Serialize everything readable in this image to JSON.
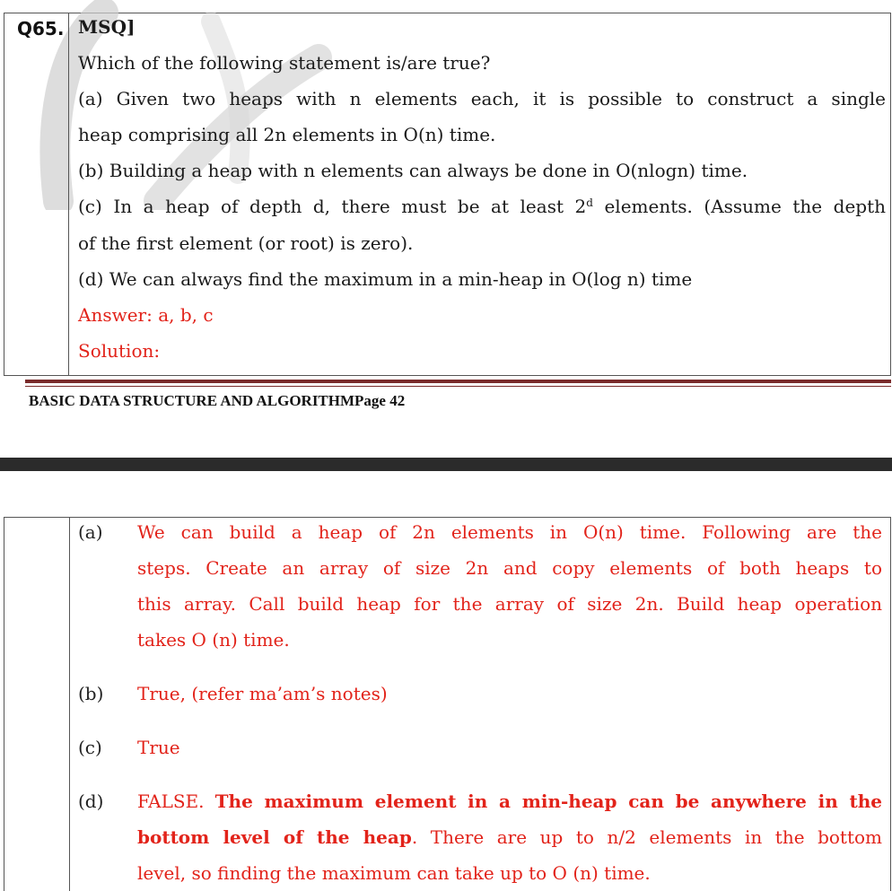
{
  "question": {
    "number": "Q65.",
    "type_tag": "MSQ]",
    "prompt": "Which of the following statement is/are true?",
    "option_a_line1": "(a) Given two heaps with n elements each, it is possible to construct a single",
    "option_a_line2": "heap comprising all 2n elements in O(n) time.",
    "option_b": "(b) Building a heap with n elements can always be done in O(nlogn) time.",
    "option_c_line1_pre": "(c) In a heap of depth d, there must be at least 2",
    "option_c_sup": "d",
    "option_c_line1_post": " elements. (Assume the depth",
    "option_c_line2": "of the first element (or root) is zero).",
    "option_d": "(d) We can always find the maximum in a min-heap in O(log n) time",
    "answer": "Answer: a, b, c",
    "solution_label": "Solution:"
  },
  "footer": {
    "text": "BASIC DATA STRUCTURE AND ALGORITHMPage 42"
  },
  "solution": {
    "a_label": "(a)",
    "a_line1": "We can build a heap of 2n elements in O(n) time. Following are the",
    "a_line2": "steps. Create an array of size 2n and copy elements of both heaps to",
    "a_line3": "this array. Call build heap for the array of size 2n. Build heap operation",
    "a_line4": "takes O (n) time.",
    "b_label": "(b)",
    "b_text": "True, (refer ma’am’s notes)",
    "c_label": "(c)",
    "c_text": "True",
    "d_label": "(d)",
    "d_line1_plain": "FALSE. ",
    "d_line1_bold": "The maximum element in a min-heap can be anywhere in the",
    "d_line2_bold": "bottom level of the heap",
    "d_line2_plain": ". There are up to n/2 elements in the bottom",
    "d_line3": "level, so finding the maximum can take up to O (n) time."
  }
}
